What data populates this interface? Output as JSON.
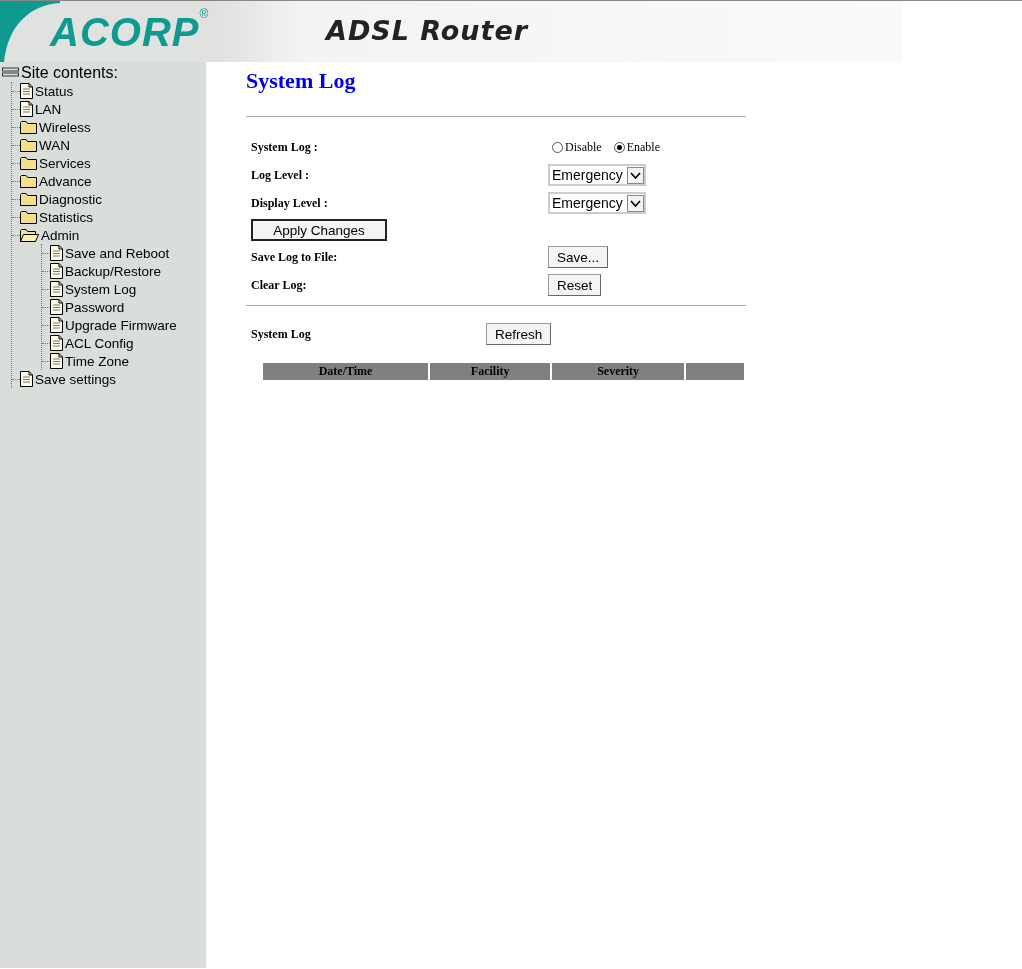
{
  "header": {
    "logo": "ACORP",
    "logo_mark": "®",
    "title": "ADSL Router"
  },
  "sidebar": {
    "title": "Site contents:",
    "items": [
      {
        "label": "Status",
        "kind": "page"
      },
      {
        "label": "LAN",
        "kind": "page"
      },
      {
        "label": "Wireless",
        "kind": "folder",
        "expanded": false
      },
      {
        "label": "WAN",
        "kind": "folder",
        "expanded": false
      },
      {
        "label": "Services",
        "kind": "folder",
        "expanded": false
      },
      {
        "label": "Advance",
        "kind": "folder",
        "expanded": false
      },
      {
        "label": "Diagnostic",
        "kind": "folder",
        "expanded": false
      },
      {
        "label": "Statistics",
        "kind": "folder",
        "expanded": false
      },
      {
        "label": "Admin",
        "kind": "folder",
        "expanded": true,
        "children": [
          {
            "label": "Save and Reboot",
            "kind": "page"
          },
          {
            "label": "Backup/Restore",
            "kind": "page"
          },
          {
            "label": "System Log",
            "kind": "page"
          },
          {
            "label": "Password",
            "kind": "page"
          },
          {
            "label": "Upgrade Firmware",
            "kind": "page"
          },
          {
            "label": "ACL Config",
            "kind": "page"
          },
          {
            "label": "Time Zone",
            "kind": "page"
          }
        ]
      },
      {
        "label": "Save settings",
        "kind": "page"
      }
    ]
  },
  "page_title": "System Log",
  "form": {
    "system_log": {
      "label": "System Log :",
      "options": [
        {
          "label": "Disable",
          "selected": false
        },
        {
          "label": "Enable",
          "selected": true
        }
      ]
    },
    "log_level": {
      "label": "Log Level :",
      "value": "Emergency"
    },
    "display_level": {
      "label": "Display Level :",
      "value": "Emergency"
    },
    "apply_button": "Apply Changes",
    "save_log": {
      "label": "Save Log to File:",
      "button": "Save..."
    },
    "clear_log": {
      "label": "Clear Log:",
      "button": "Reset"
    }
  },
  "log_section": {
    "label": "System Log",
    "button": "Refresh"
  },
  "table": {
    "columns": [
      "Date/Time",
      "Facility",
      "Severity"
    ]
  }
}
